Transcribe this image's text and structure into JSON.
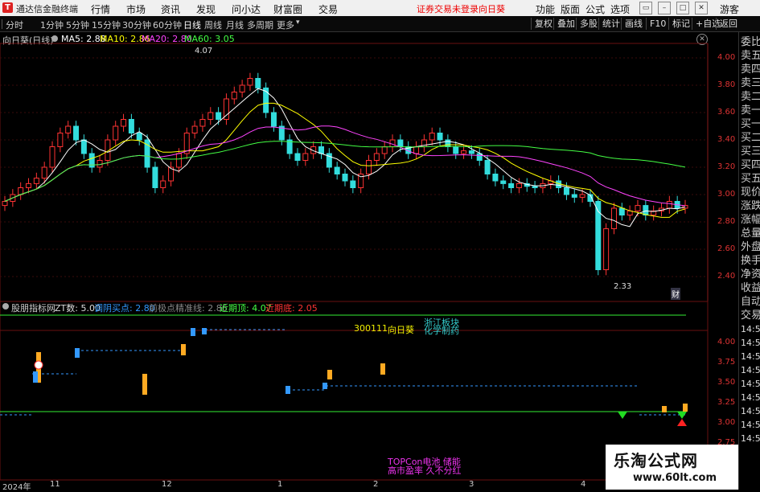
{
  "app": {
    "name": "通达信金融终端",
    "status": "证券交易未登录",
    "stock": "向日葵"
  },
  "menu": [
    "行情",
    "市场",
    "资讯",
    "发现",
    "问小达",
    "财富圈",
    "交易"
  ],
  "right_menu": [
    "功能",
    "版面",
    "公式",
    "选项"
  ],
  "guest": "游客",
  "periods": [
    "分时",
    "1分钟",
    "5分钟",
    "15分钟",
    "30分钟",
    "60分钟",
    "日线",
    "周线",
    "月线",
    "多周期",
    "更多"
  ],
  "active_period": "日线",
  "toolbar_right": [
    "复权",
    "叠加",
    "多股",
    "统计",
    "画线",
    "F10",
    "标记",
    "+自选",
    "返回"
  ],
  "main_chart": {
    "title": "向日葵(日线)",
    "ma": [
      {
        "label": "MA5: 2.88",
        "color": "#ffffff"
      },
      {
        "label": "MA10: 2.86",
        "color": "#ffff00"
      },
      {
        "label": "MA20: 2.80",
        "color": "#ff44ff"
      },
      {
        "label": "MA60: 3.05",
        "color": "#44ff44"
      }
    ],
    "high_label": "4.07",
    "low_label": "2.33",
    "cai": "财",
    "yticks": [
      "4.00",
      "3.80",
      "3.60",
      "3.40",
      "3.20",
      "3.00",
      "2.80",
      "2.60",
      "2.40"
    ]
  },
  "sub_chart": {
    "title": "股朋指标网",
    "zt": "ZT数: 5.00",
    "items": [
      {
        "label": "调阴买点: 2.80",
        "color": "#3399ff"
      },
      {
        "label": "前极点精准线: 2.86",
        "color": "#888888"
      },
      {
        "label": "近期顶: 4.07",
        "color": "#44ff44"
      },
      {
        "label": "近期底: 2.05",
        "color": "#ff3333"
      }
    ],
    "code": "300111",
    "name": "向日葵",
    "tag1": "浙江板块",
    "tag2": "化学制药",
    "tag3": "TOPCon电池 储能",
    "tag4": "高市盈率 久不分红",
    "yticks": [
      "4.00",
      "3.75",
      "3.50",
      "3.25",
      "3.00",
      "2.75"
    ]
  },
  "xaxis": [
    "2024年",
    "11",
    "12",
    "1",
    "2",
    "3",
    "4"
  ],
  "right_panel": [
    "委比",
    "卖五",
    "卖四",
    "卖三",
    "卖二",
    "卖一",
    "买一",
    "买二",
    "买三",
    "买四",
    "买五",
    "现价",
    "涨跌",
    "涨幅",
    "总量",
    "外盘",
    "换手",
    "净资",
    "收益",
    "自动",
    "交易",
    "14:56",
    "14:56",
    "14:56",
    "14:56",
    "14:56",
    "14:56",
    "14:56",
    "14:56",
    "14:56"
  ],
  "watermark": {
    "title": "乐淘公式网",
    "url": "www.60lt.com"
  },
  "chart_data": {
    "type": "candlestick",
    "closes": [
      2.95,
      3.0,
      3.05,
      3.08,
      3.12,
      3.2,
      3.35,
      3.45,
      3.5,
      3.4,
      3.3,
      3.2,
      3.25,
      3.4,
      3.5,
      3.55,
      3.45,
      3.4,
      3.2,
      3.05,
      3.1,
      3.2,
      3.3,
      3.45,
      3.5,
      3.55,
      3.6,
      3.55,
      3.7,
      3.75,
      3.8,
      3.85,
      3.78,
      3.6,
      3.5,
      3.4,
      3.3,
      3.25,
      3.3,
      3.35,
      3.3,
      3.2,
      3.15,
      3.1,
      3.05,
      3.15,
      3.25,
      3.3,
      3.35,
      3.4,
      3.35,
      3.3,
      3.35,
      3.4,
      3.45,
      3.4,
      3.35,
      3.3,
      3.32,
      3.3,
      3.25,
      3.15,
      3.1,
      3.08,
      3.05,
      3.08,
      3.06,
      3.05,
      3.08,
      3.1,
      3.05,
      3.0,
      2.98,
      3.0,
      2.95,
      2.45,
      2.75,
      2.9,
      2.85,
      2.88,
      2.92,
      2.85,
      2.88,
      2.9,
      2.95,
      2.9,
      2.92
    ],
    "ylim": [
      2.33,
      4.07
    ]
  }
}
